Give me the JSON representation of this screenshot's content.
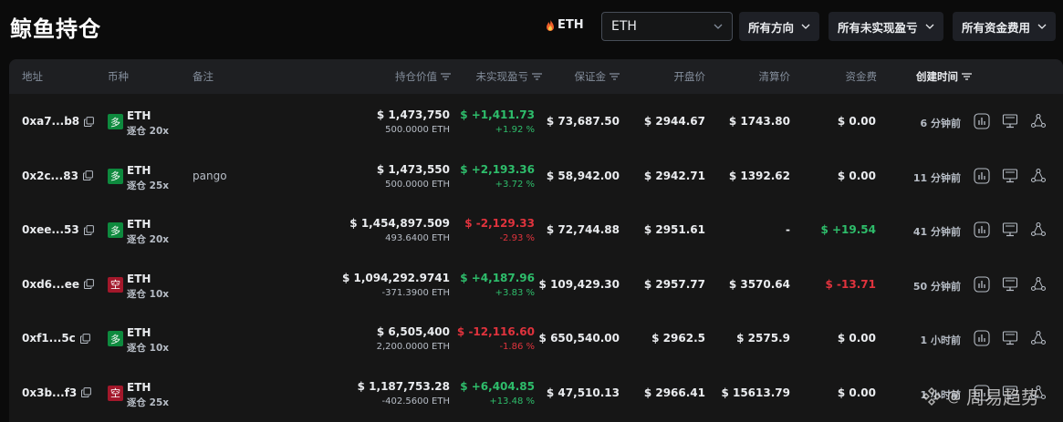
{
  "header": {
    "title": "鲸鱼持仓",
    "coin_tag": "ETH",
    "coin_select": "ETH",
    "filters": [
      "所有方向",
      "所有未实现盈亏",
      "所有资金费用"
    ]
  },
  "columns": {
    "address": "地址",
    "coin": "币种",
    "note": "备注",
    "position_value": "持仓价值",
    "unrealized_pnl": "未实现盈亏",
    "margin": "保证金",
    "entry_price": "开盘价",
    "liq_price": "清算价",
    "funding": "资金费",
    "created": "创建时间"
  },
  "rows": [
    {
      "address": "0xa7...b8",
      "side": "多",
      "coin": "ETH",
      "mode": "逐仓 20x",
      "note": "",
      "value": "$ 1,473,750",
      "size": "500.0000 ETH",
      "pnl": "$ +1,411.73",
      "pnl_pct": "+1.92 %",
      "margin": "$ 73,687.50",
      "entry": "$ 2944.67",
      "liq": "$ 1743.80",
      "funding": "$ 0.00",
      "created": "6 分钟前"
    },
    {
      "address": "0x2c...83",
      "side": "多",
      "coin": "ETH",
      "mode": "逐仓 25x",
      "note": "pango",
      "value": "$ 1,473,550",
      "size": "500.0000 ETH",
      "pnl": "$ +2,193.36",
      "pnl_pct": "+3.72 %",
      "margin": "$ 58,942.00",
      "entry": "$ 2942.71",
      "liq": "$ 1392.62",
      "funding": "$ 0.00",
      "created": "11 分钟前"
    },
    {
      "address": "0xee...53",
      "side": "多",
      "coin": "ETH",
      "mode": "逐仓 20x",
      "note": "",
      "value": "$ 1,454,897.509",
      "size": "493.6400 ETH",
      "pnl": "$ -2,129.33",
      "pnl_pct": "-2.93 %",
      "margin": "$ 72,744.88",
      "entry": "$ 2951.61",
      "liq": "-",
      "funding": "$ +19.54",
      "created": "41 分钟前"
    },
    {
      "address": "0xd6...ee",
      "side": "空",
      "coin": "ETH",
      "mode": "逐仓 10x",
      "note": "",
      "value": "$ 1,094,292.9741",
      "size": "-371.3900 ETH",
      "pnl": "$ +4,187.96",
      "pnl_pct": "+3.83 %",
      "margin": "$ 109,429.30",
      "entry": "$ 2957.77",
      "liq": "$ 3570.64",
      "funding": "$ -13.71",
      "created": "50 分钟前"
    },
    {
      "address": "0xf1...5c",
      "side": "多",
      "coin": "ETH",
      "mode": "逐仓 10x",
      "note": "",
      "value": "$ 6,505,400",
      "size": "2,200.0000 ETH",
      "pnl": "$ -12,116.60",
      "pnl_pct": "-1.86 %",
      "margin": "$ 650,540.00",
      "entry": "$ 2962.5",
      "liq": "$ 2575.9",
      "funding": "$ 0.00",
      "created": "1 小时前"
    },
    {
      "address": "0x3b...f3",
      "side": "空",
      "coin": "ETH",
      "mode": "逐仓 25x",
      "note": "",
      "value": "$ 1,187,753.28",
      "size": "-402.5600 ETH",
      "pnl": "$ +6,404.85",
      "pnl_pct": "+13.48 %",
      "margin": "$ 47,510.13",
      "entry": "$ 2966.41",
      "liq": "$ 15613.79",
      "funding": "$ 0.00",
      "created": "1 小时前"
    }
  ],
  "watermark": "周易趋势",
  "colors": {
    "long": "#0e8a3e",
    "short": "#a3182b",
    "positive": "#2ebd6b",
    "negative": "#e0333d"
  },
  "icons": [
    "copy-icon",
    "chart-icon",
    "monitor-icon",
    "share-icon",
    "flame-icon",
    "chevron-down-icon",
    "sort-icon"
  ]
}
